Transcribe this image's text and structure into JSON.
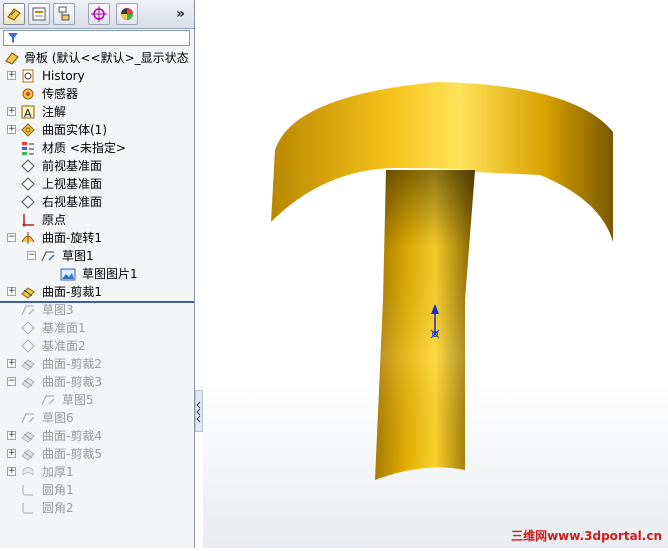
{
  "toolbar": {
    "tabs": [
      "feature-manager-icon",
      "property-manager-icon",
      "configuration-manager-icon",
      "dimxpert-icon",
      "display-manager-icon"
    ],
    "more": "»"
  },
  "filter": {
    "icon": "filter-icon"
  },
  "tree": {
    "root": "骨板 (默认<<默认>_显示状态",
    "items": [
      {
        "label": "History",
        "icon": "history-icon",
        "expander": true,
        "disabled": false
      },
      {
        "label": "传感器",
        "icon": "sensor-icon",
        "expander": false,
        "disabled": false
      },
      {
        "label": "注解",
        "icon": "annotation-icon",
        "expander": true,
        "disabled": false
      },
      {
        "label": "曲面实体(1)",
        "icon": "surface-bodies-icon",
        "expander": true,
        "disabled": false
      },
      {
        "label": "材质 <未指定>",
        "icon": "material-icon",
        "expander": false,
        "disabled": false
      },
      {
        "label": "前视基准面",
        "icon": "plane-icon",
        "expander": false,
        "disabled": false
      },
      {
        "label": "上视基准面",
        "icon": "plane-icon",
        "expander": false,
        "disabled": false
      },
      {
        "label": "右视基准面",
        "icon": "plane-icon",
        "expander": false,
        "disabled": false
      },
      {
        "label": "原点",
        "icon": "origin-icon",
        "expander": false,
        "disabled": false
      },
      {
        "label": "曲面-旋转1",
        "icon": "surface-revolve-icon",
        "expander": true,
        "disabled": false
      },
      {
        "label": "草图1",
        "icon": "sketch-icon",
        "expander": true,
        "disabled": false
      },
      {
        "label": "草图图片1",
        "icon": "sketch-picture-icon",
        "expander": false,
        "disabled": false
      },
      {
        "label": "曲面-剪裁1",
        "icon": "surface-trim-icon",
        "expander": true,
        "disabled": false
      },
      {
        "label": "草图3",
        "icon": "sketch-icon",
        "expander": false,
        "disabled": true
      },
      {
        "label": "基准面1",
        "icon": "plane-icon",
        "expander": false,
        "disabled": true
      },
      {
        "label": "基准面2",
        "icon": "plane-icon",
        "expander": false,
        "disabled": true
      },
      {
        "label": "曲面-剪裁2",
        "icon": "surface-trim-icon",
        "expander": true,
        "disabled": true
      },
      {
        "label": "曲面-剪裁3",
        "icon": "surface-trim-icon",
        "expander": true,
        "disabled": true
      },
      {
        "label": "草图5",
        "icon": "sketch-icon",
        "expander": false,
        "disabled": true
      },
      {
        "label": "草图6",
        "icon": "sketch-icon",
        "expander": false,
        "disabled": true
      },
      {
        "label": "曲面-剪裁4",
        "icon": "surface-trim-icon",
        "expander": true,
        "disabled": true
      },
      {
        "label": "曲面-剪裁5",
        "icon": "surface-trim-icon",
        "expander": true,
        "disabled": true
      },
      {
        "label": "加厚1",
        "icon": "thicken-icon",
        "expander": true,
        "disabled": true
      },
      {
        "label": "圆角1",
        "icon": "fillet-icon",
        "expander": false,
        "disabled": true
      },
      {
        "label": "圆角2",
        "icon": "fillet-icon",
        "expander": false,
        "disabled": true
      }
    ]
  },
  "viewport": {
    "model_color": "#e8b400",
    "triad_color": "#1a2fc8"
  },
  "watermark": "三维网www.3dportal.cn"
}
